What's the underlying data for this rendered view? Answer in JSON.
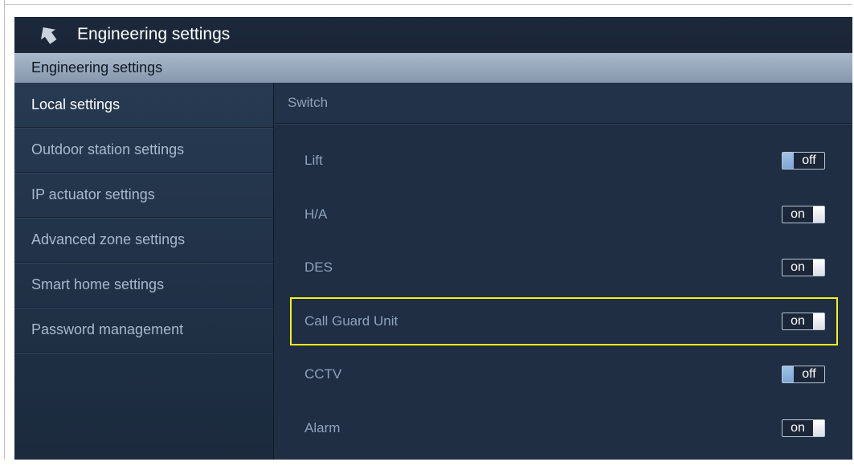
{
  "window": {
    "title": "Engineering settings"
  },
  "subheader": {
    "title": "Engineering settings"
  },
  "sidebar": {
    "items": [
      {
        "label": "Local settings",
        "active": true
      },
      {
        "label": "Outdoor station settings",
        "active": false
      },
      {
        "label": "IP actuator settings",
        "active": false
      },
      {
        "label": "Advanced zone settings",
        "active": false
      },
      {
        "label": "Smart home settings",
        "active": false
      },
      {
        "label": "Password management",
        "active": false
      }
    ]
  },
  "content": {
    "section_title": "Switch",
    "rows": [
      {
        "label": "Lift",
        "state": "off"
      },
      {
        "label": "H/A",
        "state": "on"
      },
      {
        "label": "DES",
        "state": "on"
      },
      {
        "label": "Call Guard Unit",
        "state": "on",
        "highlighted": true
      },
      {
        "label": "CCTV",
        "state": "off"
      },
      {
        "label": "Alarm",
        "state": "on"
      }
    ]
  },
  "colors": {
    "highlight": "#f3f21a",
    "background": "#1e2c3f",
    "subheader": "#97a8bd"
  },
  "icons": {
    "back": "back-arrow-icon"
  }
}
